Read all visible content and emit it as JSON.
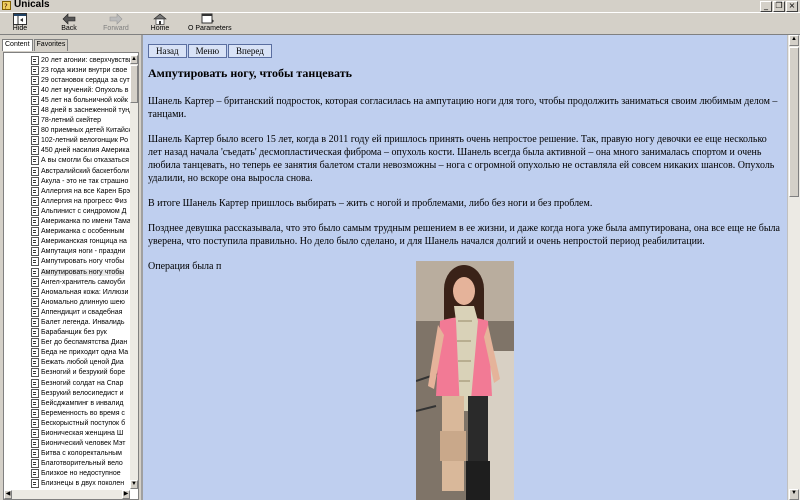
{
  "window": {
    "title": "Unicals"
  },
  "toolbar": {
    "hide": "Hide",
    "back": "Back",
    "forward": "Forward",
    "home": "Home",
    "parameters": "O Parameters"
  },
  "sidebar": {
    "tabs": [
      "Content",
      "Favorites"
    ],
    "items": [
      "20 лет агонии: сверхчувствит",
      "23 года жизни внутри свое",
      "29 остановок сердца за сут",
      "40 лет мучений: Опухоль в",
      "45 лет на больничной койк",
      "48 дней в заснеженной тундр",
      "78-летний скейтер",
      "80 приемных детей Китайск",
      "102-летний велогонщик Ро",
      "450 дней насилия Америка",
      "А вы смогли бы отказаться",
      "Австралийский баскетболи",
      "Акула - это не так страшно",
      "Аллергия на все Карен Брэ",
      "Аллергия на прогресс Физ",
      "Альпинист с синдромом Д",
      "Американка по имени Тама",
      "Американка с особенным",
      "Американская гонщица на",
      "Ампутация ноги - праздни",
      "Ампутировать ногу чтобы",
      "Ампутировать ногу чтобы",
      "Ангел-хранитель самоуби",
      "Аномальная кожа: Иллюзи",
      "Аномально длинную шею",
      "Аппендицит и свадебная",
      "Балет легенда. Инвалидь",
      "Барабанщик без рук",
      "Бег до беспамятства Диан",
      "Беда не приходит одна Ма",
      "Бежать любой ценой Диа",
      "Безногий и безрукий боре",
      "Безногий солдат на Спар",
      "Безрукий велосипедист и",
      "Бейсджампинг в инвалид",
      "Беременность во время с",
      "Бескорыстный поступок б",
      "Бионическая женщина Ш",
      "Бионический человек Мэт",
      "Битва с колоректальным",
      "Благотворительный вело",
      "Близкое но недоступное",
      "Близнецы в двух поколен"
    ],
    "selected_index": 21
  },
  "nav": {
    "back": "Назад",
    "menu": "Меню",
    "forward": "Вперед"
  },
  "article": {
    "title": "Ампутировать ногу, чтобы танцевать",
    "paragraphs": [
      "Шанель Картер – британский подросток, которая согласилась на ампутацию ноги для того, чтобы продолжить заниматься своим любимым делом – танцами.",
      "Шанель Картер было всего 15 лет, когда в 2011 году ей пришлось принять очень непростое решение. Так, правую ногу девочки ее еще несколько лет назад начала 'съедать' десмопластическая фиброма – опухоль кости. Шанель всегда была активной – она много занималась спортом и очень любила танцевать, но теперь ее занятия балетом стали невозможны – нога с огромной опухолью не оставляла ей совсем никаких шансов. Опухоль удалили, но вскоре она выросла снова.",
      "В итоге Шанель Картер пришлось выбирать – жить с ногой и проблемами, либо без ноги и без проблем.",
      "Позднее девушка рассказывала, что это было самым трудным решением в ее жизни, и даже когда нога уже была ампутирована, она все еще не была уверена, что поступила правильно. Но дело было сделано, и для Шанель начался долгий и очень непростой период реабилитации.",
      "Операция была п"
    ]
  }
}
